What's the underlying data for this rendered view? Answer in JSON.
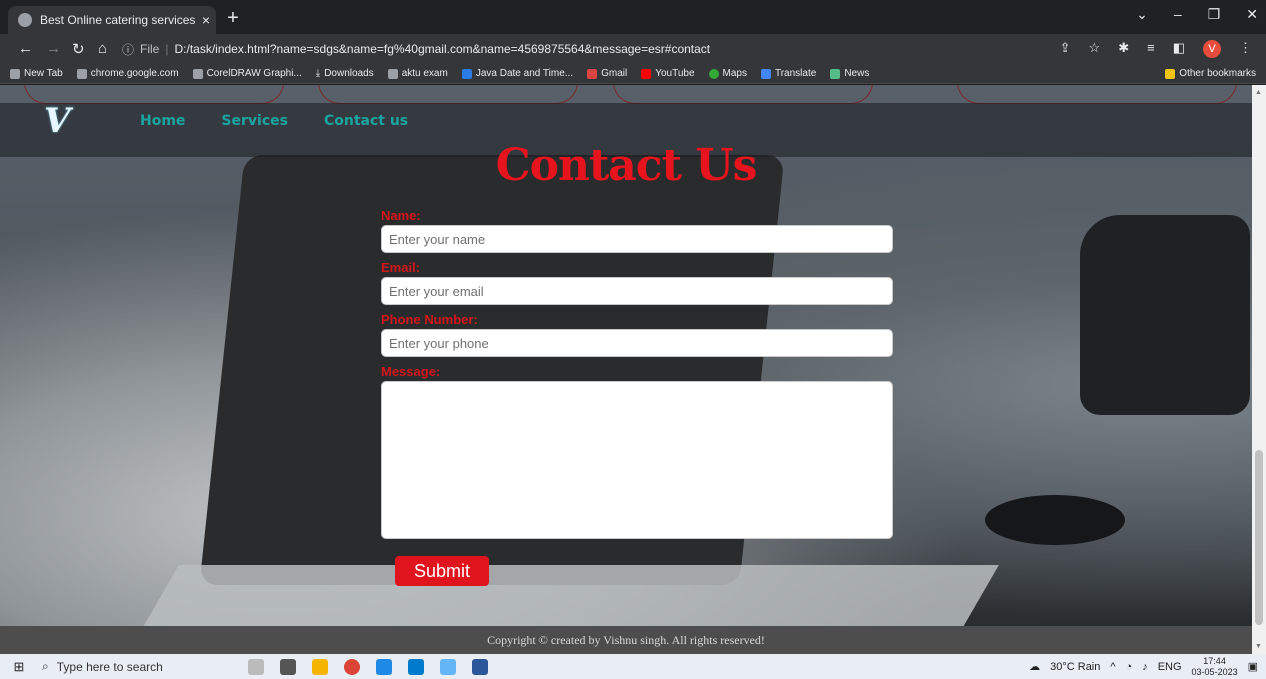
{
  "browser": {
    "tab_title": "Best Online catering services for",
    "tab_close": "×",
    "new_tab": "+",
    "url_prefix": "File",
    "url": "D:/task/index.html?name=sdgs&name=fg%40gmail.com&name=4569875564&message=esr#contact",
    "profile_initial": "V",
    "bookmarks": [
      "New Tab",
      "chrome.google.com",
      "CorelDRAW Graphi...",
      "Downloads",
      "aktu exam",
      "Java Date and Time...",
      "Gmail",
      "YouTube",
      "Maps",
      "Translate",
      "News"
    ],
    "other_bookmarks": "Other bookmarks"
  },
  "site": {
    "logo": "V",
    "nav": [
      "Home",
      "Services",
      "Contact us"
    ],
    "heading": "Contact Us",
    "form": {
      "name_label": "Name:",
      "name_placeholder": "Enter your name",
      "email_label": "Email:",
      "email_placeholder": "Enter your email",
      "phone_label": "Phone Number:",
      "phone_placeholder": "Enter your phone",
      "message_label": "Message:",
      "submit_label": "Submit"
    },
    "footer": "Copyright © created by Vishnu singh. All rights reserved!"
  },
  "taskbar": {
    "search_placeholder": "Type here to search",
    "weather": "30°C Rain",
    "language": "ENG",
    "time": "17:44",
    "date": "03-05-2023"
  },
  "colors": {
    "accent": "#e0141c",
    "nav_link": "#1aa5a0",
    "label": "#d4151b"
  }
}
